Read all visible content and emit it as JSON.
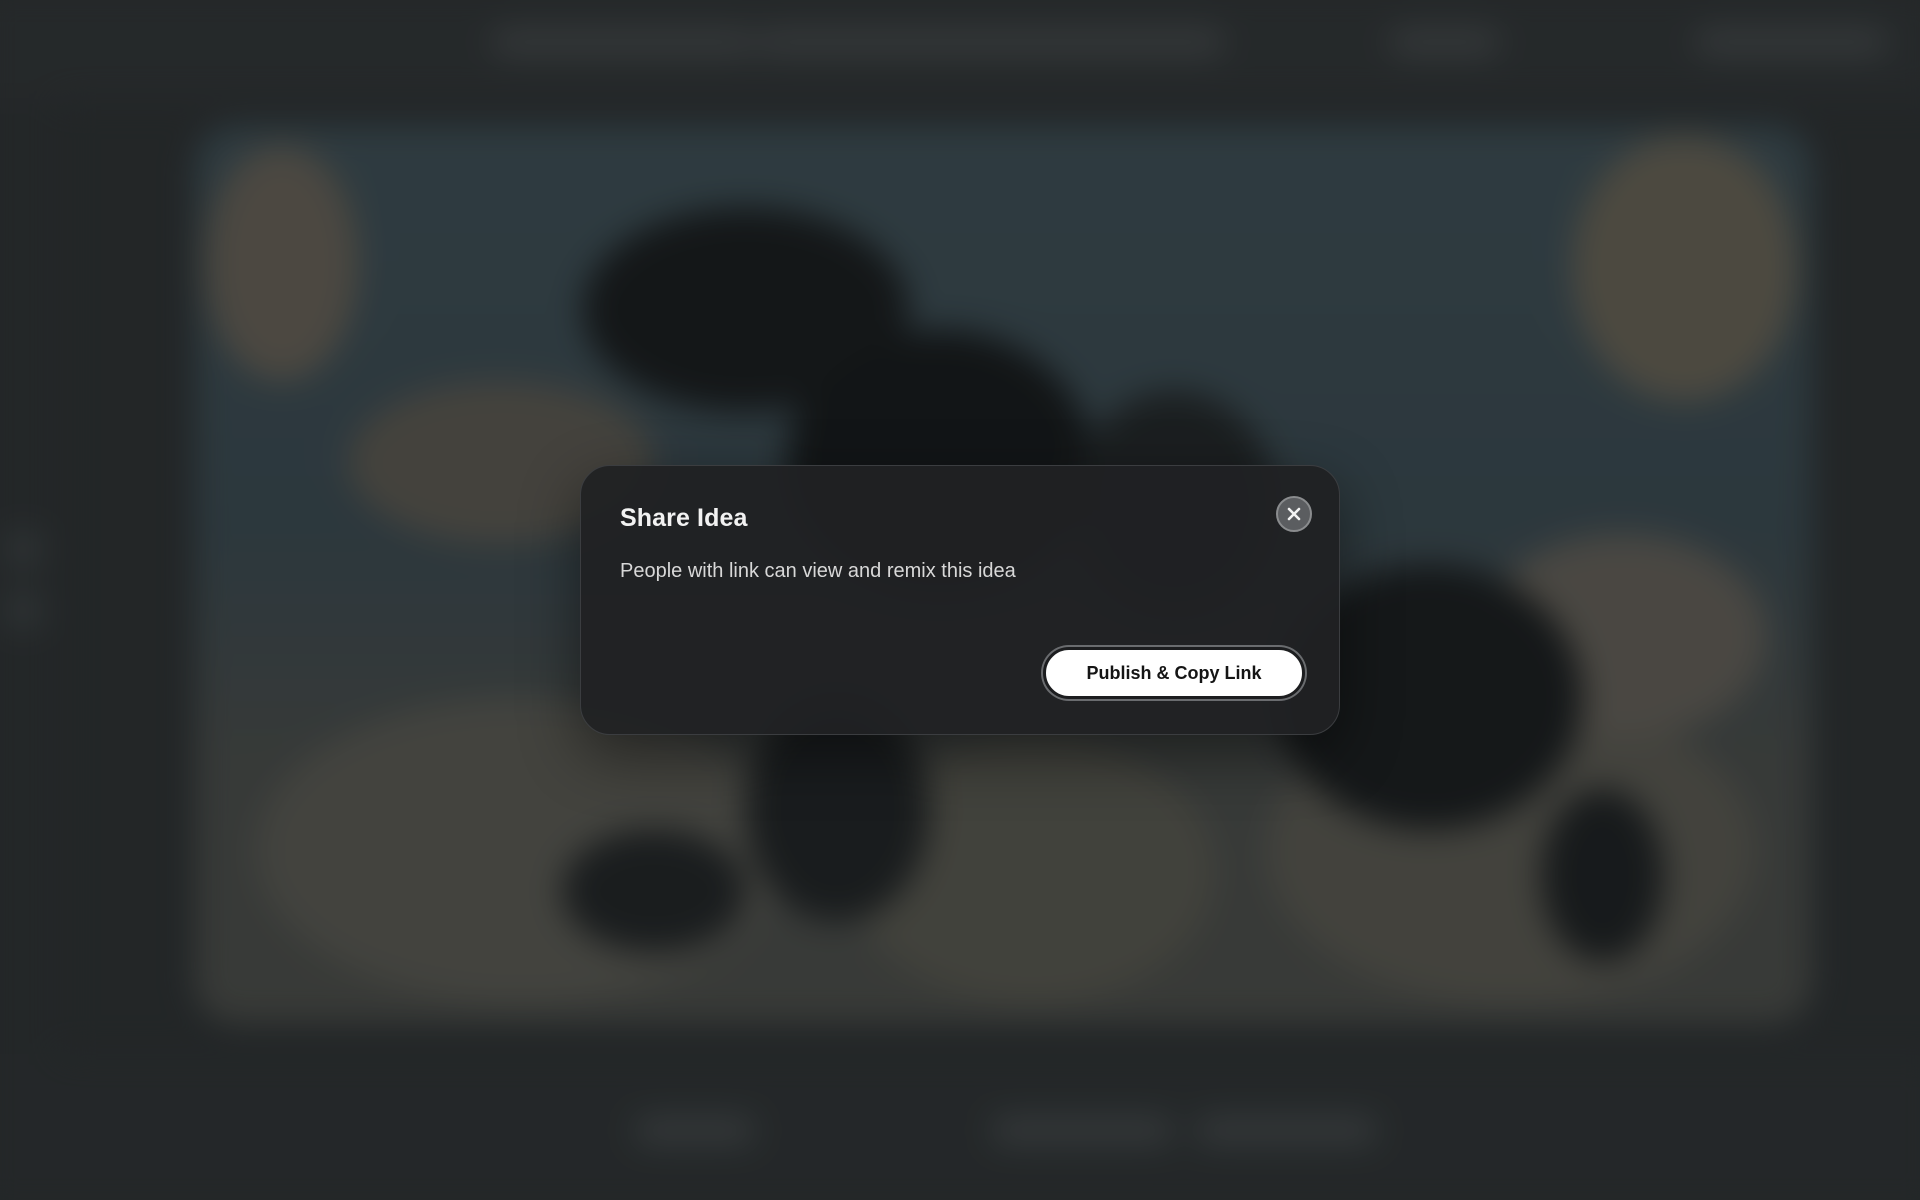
{
  "dialog": {
    "title": "Share Idea",
    "description": "People with link can view and remix this idea",
    "primary_button_label": "Publish & Copy Link",
    "close_icon": "close-icon"
  },
  "colors": {
    "dialog_background": "#202123",
    "primary_button_background": "#ffffff",
    "primary_button_text": "#151515",
    "close_button_background": "#5b5d60"
  }
}
